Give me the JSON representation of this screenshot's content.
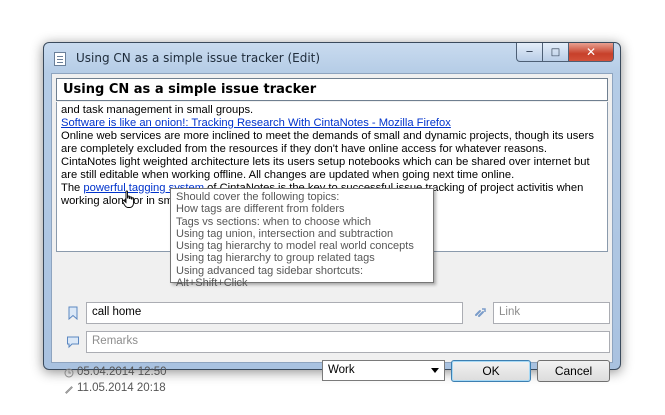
{
  "window": {
    "title": "Using CN as a simple issue tracker (Edit)",
    "controls": {
      "minimize": "─",
      "maximize": "□",
      "close": "✕"
    }
  },
  "note": {
    "title": "Using CN as a simple issue tracker",
    "body": {
      "line1": "and task management in small groups.",
      "link1": "Software is like an onion!: Tracking Research With CintaNotes - Mozilla Firefox",
      "para2": "Online web services are more inclined to meet the demands of small and dynamic projects, though its users are completely excluded from the resources if they don't have online access for whatever reasons.",
      "para3": "CintaNotes light weighted architecture lets its users setup notebooks which can be shared over internet but are still editable when working offline. All changes are updated when going next time online.",
      "para4_pre": "The ",
      "para4_link": "powerful tagging system",
      "para4_post": " of CintaNotes is the key to successful issue tracking of project activitis when",
      "para5": "working alone or in small"
    }
  },
  "tooltip": {
    "lines": [
      "Should cover the following topics:",
      "How tags are different from folders",
      "Tags vs sections: when to choose which",
      "Using tag union, intersection and subtraction",
      "Using tag hierarchy to model real world concepts",
      "Using tag hierarchy to group related tags",
      "Using advanced tag sidebar shortcuts: Alt+Shift+Click"
    ]
  },
  "fields": {
    "tags_value": "call home",
    "link_placeholder": "Link",
    "remarks_placeholder": "Remarks"
  },
  "dates": {
    "created": "05.04.2014 12:50",
    "modified": "11.05.2014 20:18"
  },
  "section_select": {
    "value": "Work"
  },
  "buttons": {
    "ok": "OK",
    "cancel": "Cancel"
  },
  "icons": {
    "tag": "bookmark-icon",
    "link": "link-icon",
    "remarks": "speech-bubble-icon",
    "created": "clock-icon",
    "modified": "pencil-icon"
  },
  "colors": {
    "link": "#0033cc",
    "accent": "#3c7fb1"
  }
}
